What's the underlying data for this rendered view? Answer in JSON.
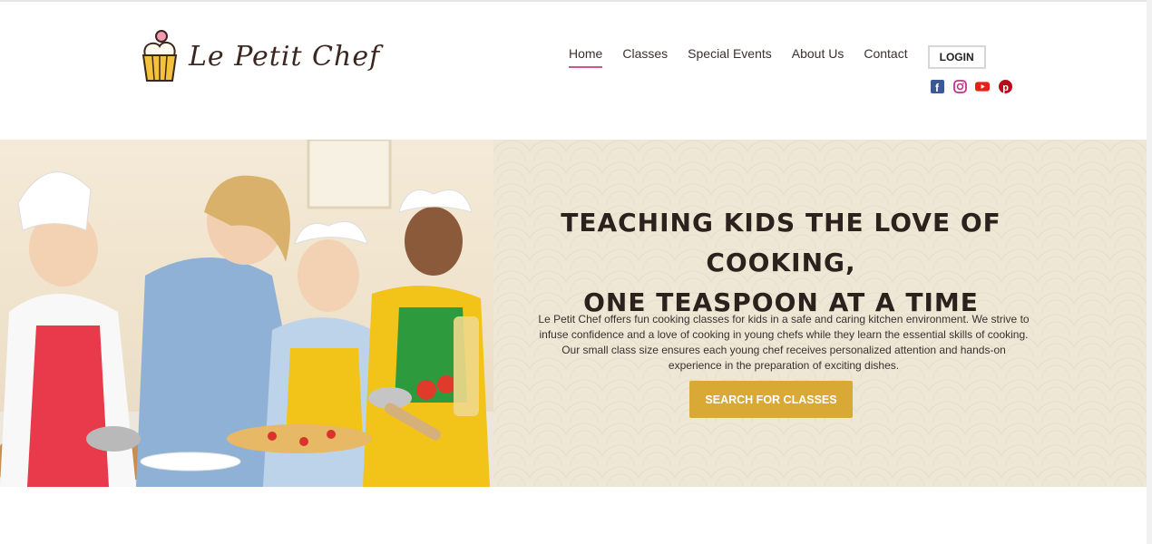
{
  "brand": {
    "name": "Le Petit Chef"
  },
  "nav": {
    "items": [
      {
        "label": "Home",
        "active": true
      },
      {
        "label": "Classes"
      },
      {
        "label": "Special Events"
      },
      {
        "label": "About Us"
      },
      {
        "label": "Contact"
      }
    ],
    "login_label": "LOGIN"
  },
  "social": [
    "facebook-icon",
    "instagram-icon",
    "youtube-icon",
    "pinterest-icon"
  ],
  "hero": {
    "headline_line1": "TEACHING KIDS THE LOVE OF COOKING,",
    "headline_line2": "ONE TEASPOON AT A TIME",
    "description": "Le Petit Chef offers fun cooking classes for kids in a safe and caring kitchen environment. We strive to infuse confidence and a love of cooking in young chefs while they learn the essential skills of cooking. Our small class size ensures each young chef receives personalized attention and hands-on experience in the preparation of exciting dishes.",
    "cta_label": "SEARCH FOR CLASSES"
  },
  "colors": {
    "accent": "#c95a8a",
    "cta": "#d9a935",
    "pattern_bg": "#efe7d5",
    "facebook": "#3b5998",
    "instagram": "#c13584",
    "youtube": "#e62117",
    "pinterest": "#bd081c"
  }
}
